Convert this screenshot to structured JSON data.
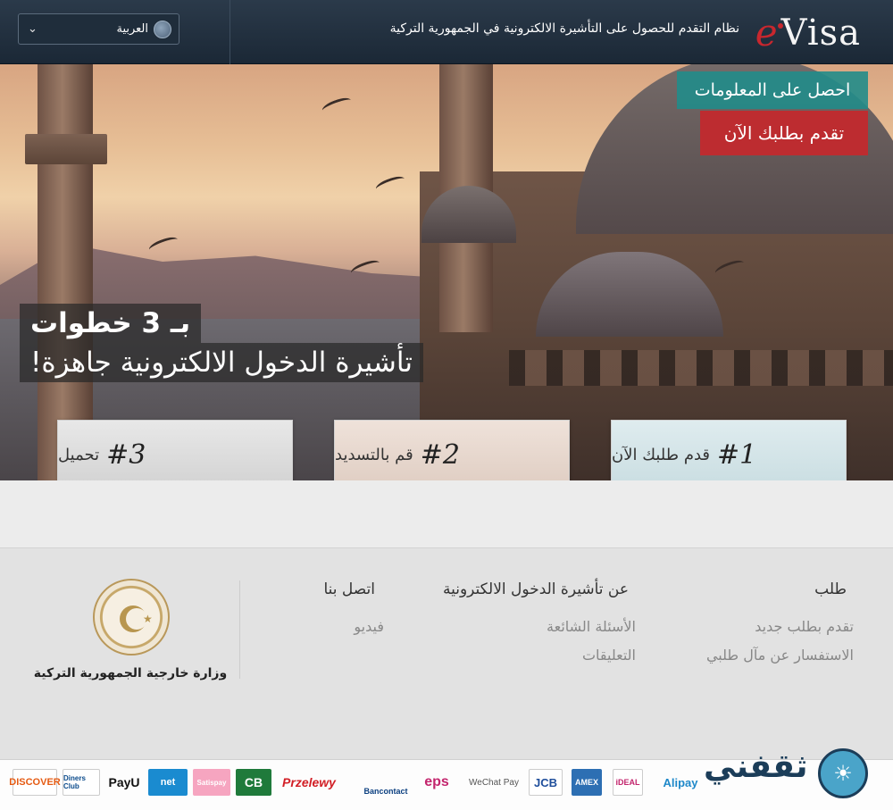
{
  "header": {
    "language": "العربية",
    "title": "نظام التقدم للحصول على التأشيرة الالكترونية في الجمهورية التركية",
    "logo_e": "e",
    "logo_visa": "Visa"
  },
  "hero": {
    "info_button": "احصل على المعلومات",
    "apply_button": "تقدم بطلبك الآن",
    "tagline_line1": "بـ 3 خطوات",
    "tagline_line2": "تأشيرة الدخول الالكترونية جاهزة!",
    "steps": [
      {
        "num": "#1",
        "label": "قدم طلبك الآن"
      },
      {
        "num": "#2",
        "label": "قم بالتسديد"
      },
      {
        "num": "#3",
        "label": "تحميل"
      }
    ]
  },
  "footer": {
    "col1": {
      "heading": "طلب",
      "links": [
        "تقدم بطلب جديد",
        "الاستفسار عن مآل طلبي"
      ]
    },
    "col2": {
      "heading": "عن تأشيرة الدخول الالكترونية",
      "links": [
        "الأسئلة الشائعة",
        "التعليقات"
      ]
    },
    "col3": {
      "heading": "اتصل بنا",
      "links": [
        "فيديو"
      ]
    },
    "ministry": "وزارة خارجية الجمهورية التركية"
  },
  "payments": [
    "DISCOVER",
    "Diners Club",
    "PayU",
    "net",
    "Satispay",
    "CB",
    "Przelewy",
    "Bancontact",
    "eps",
    "WeChat Pay",
    "JCB",
    "AMEX",
    "iDEAL",
    "Alipay"
  ],
  "watermark": "ثقفني"
}
